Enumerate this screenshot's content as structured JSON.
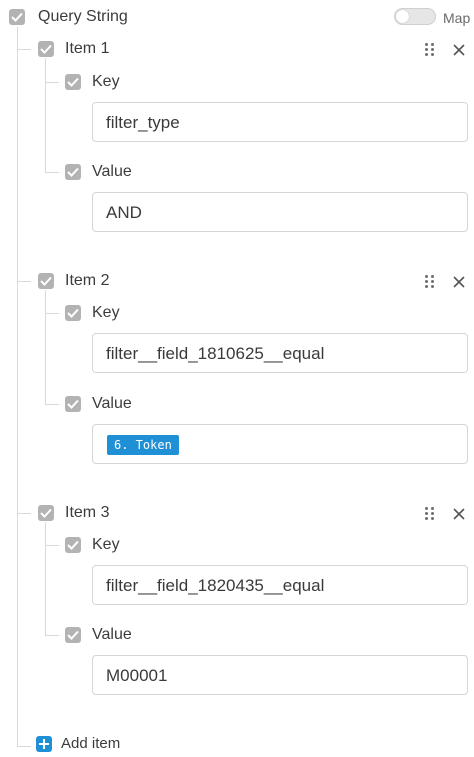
{
  "query_string": {
    "label": "Query String",
    "toggle_label": "Map"
  },
  "items": [
    {
      "title": "Item 1",
      "key_label": "Key",
      "key_value": "filter_type",
      "value_label": "Value",
      "value_value": "AND"
    },
    {
      "title": "Item 2",
      "key_label": "Key",
      "key_value": "filter__field_1810625__equal",
      "value_label": "Value",
      "value_token": "6. Token"
    },
    {
      "title": "Item 3",
      "key_label": "Key",
      "key_value": "filter__field_1820435__equal",
      "value_label": "Value",
      "value_value": "M00001"
    }
  ],
  "add_item_label": "Add item",
  "colors": {
    "checkbox": "#b3b3b3",
    "accent": "#1f8fd6",
    "border": "#d6d6d6"
  },
  "icons": {
    "checkbox": "check-icon",
    "drag": "drag-handle-icon",
    "remove": "close-icon",
    "add": "plus-icon"
  }
}
